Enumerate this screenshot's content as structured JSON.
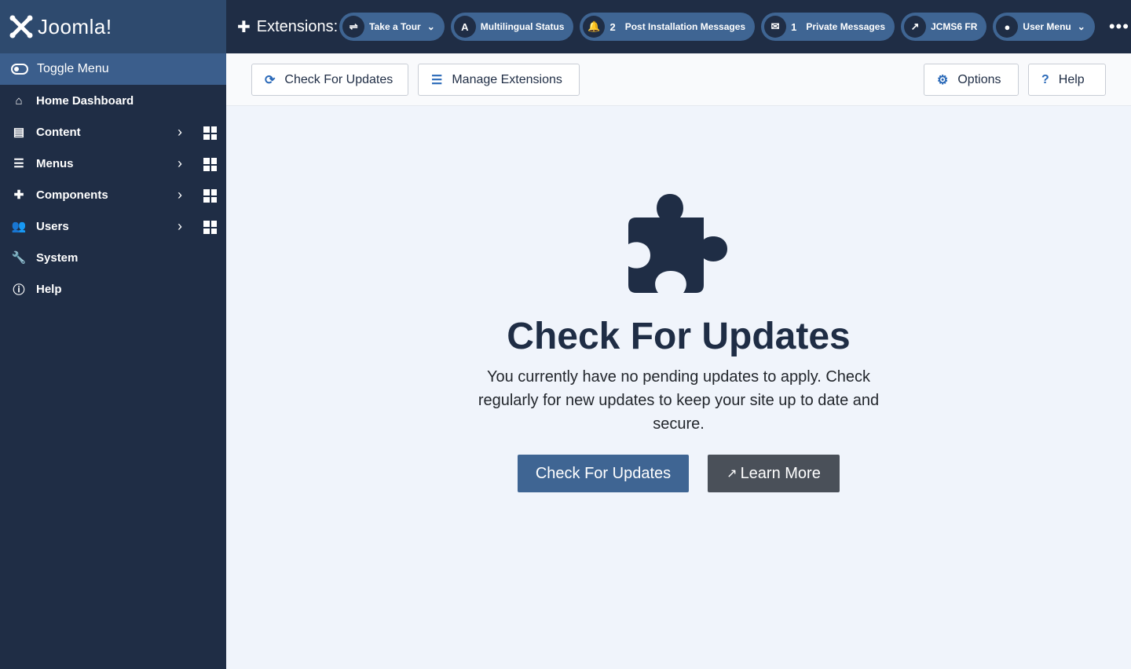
{
  "brand": {
    "name": "Joomla!"
  },
  "sidebar": {
    "toggle": "Toggle Menu",
    "items": [
      {
        "label": "Home Dashboard",
        "icon": "home-icon"
      },
      {
        "label": "Content",
        "icon": "file-icon",
        "submenu": true
      },
      {
        "label": "Menus",
        "icon": "list-icon",
        "submenu": true
      },
      {
        "label": "Components",
        "icon": "puzzle-icon",
        "submenu": true
      },
      {
        "label": "Users",
        "icon": "users-icon",
        "submenu": true
      },
      {
        "label": "System",
        "icon": "wrench-icon"
      },
      {
        "label": "Help",
        "icon": "info-icon"
      }
    ]
  },
  "header": {
    "title": "Extensions:",
    "pills": [
      {
        "label": "Take a Tour",
        "icon": "signpost-icon"
      },
      {
        "label": "Multilingual Status",
        "icon": "language-icon"
      },
      {
        "label": "Post Installation Messages",
        "count": "2",
        "icon": "bell-icon"
      },
      {
        "label": "Private Messages",
        "count": "1",
        "icon": "envelope-icon"
      },
      {
        "label": "JCMS6 FR",
        "icon": "external-link-icon"
      },
      {
        "label": "User Menu",
        "icon": "user-icon"
      }
    ]
  },
  "toolbar": {
    "check": "Check For Updates",
    "manage": "Manage Extensions",
    "options": "Options",
    "help": "Help"
  },
  "main": {
    "title": "Check For Updates",
    "description": "You currently have no pending updates to apply. Check regularly for new updates to keep your site up to date and secure.",
    "primary": "Check For Updates",
    "secondary": "Learn More"
  },
  "colors": {
    "sidebar": "#1f2d45",
    "brand_bg": "#2e4a6e",
    "accent": "#3f6593",
    "secondary": "#4a5059"
  }
}
